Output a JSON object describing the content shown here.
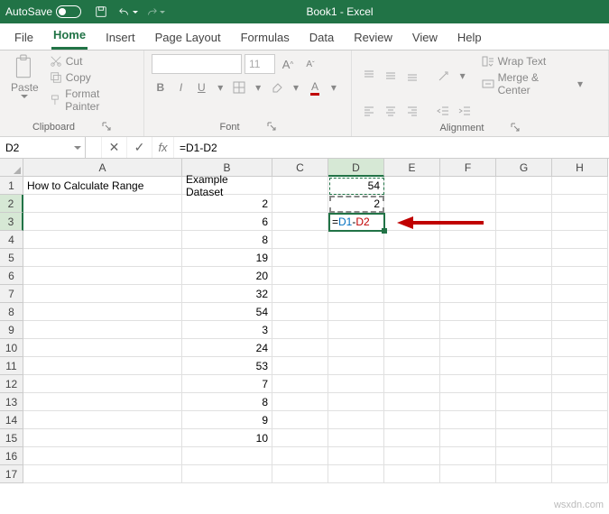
{
  "titlebar": {
    "autosave": "AutoSave",
    "title": "Book1 - Excel"
  },
  "tabs": {
    "file": "File",
    "home": "Home",
    "insert": "Insert",
    "pagelayout": "Page Layout",
    "formulas": "Formulas",
    "data": "Data",
    "review": "Review",
    "view": "View",
    "help": "Help"
  },
  "ribbon": {
    "clipboard": {
      "paste": "Paste",
      "cut": "Cut",
      "copy": "Copy",
      "formatpainter": "Format Painter",
      "label": "Clipboard"
    },
    "font": {
      "size": "11",
      "bold": "B",
      "italic": "I",
      "underline": "U",
      "bigA": "A",
      "smallA": "A",
      "label": "Font"
    },
    "alignment": {
      "wrap": "Wrap Text",
      "merge": "Merge & Center",
      "label": "Alignment"
    }
  },
  "namebox": "D2",
  "formula": "=D1-D2",
  "columns": [
    "A",
    "B",
    "C",
    "D",
    "E",
    "F",
    "G",
    "H"
  ],
  "editing_formula": {
    "eq": "=",
    "ref1": "D1",
    "dash": "-",
    "ref2": "D2"
  },
  "chart_data": {
    "type": "table",
    "columns": [
      "A",
      "B",
      "C",
      "D"
    ],
    "rows": [
      {
        "n": 1,
        "A": "How to Calculate Range",
        "B": "Example Dataset",
        "D": 54
      },
      {
        "n": 2,
        "B": 2,
        "D": 2
      },
      {
        "n": 3,
        "B": 6,
        "D": "=D1-D2"
      },
      {
        "n": 4,
        "B": 8
      },
      {
        "n": 5,
        "B": 19
      },
      {
        "n": 6,
        "B": 20
      },
      {
        "n": 7,
        "B": 32
      },
      {
        "n": 8,
        "B": 54
      },
      {
        "n": 9,
        "B": 3
      },
      {
        "n": 10,
        "B": 24
      },
      {
        "n": 11,
        "B": 53
      },
      {
        "n": 12,
        "B": 7
      },
      {
        "n": 13,
        "B": 8
      },
      {
        "n": 14,
        "B": 9
      },
      {
        "n": 15,
        "B": 10
      },
      {
        "n": 16
      },
      {
        "n": 17
      }
    ]
  },
  "watermark": "wsxdn.com"
}
